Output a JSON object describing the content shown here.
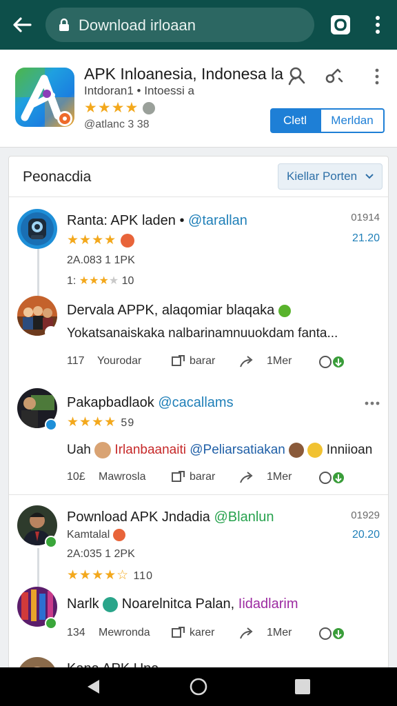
{
  "browser": {
    "url": "Download irloaan",
    "tab_count": "0"
  },
  "app": {
    "name": "APK Inloanesia, Indonesa la",
    "subtitle": "Intdoran1 • Intoessi a",
    "stars": "★★★★",
    "meta": "@atlanc 3 38",
    "primary_button": "Cletl",
    "secondary_button": "Merldan"
  },
  "feed": {
    "title": "Peonacdia",
    "sort_label": "Kiellar Porten",
    "items": [
      {
        "name": "Ranta: APK laden",
        "handle": "@tarallan",
        "time": "01914",
        "date": "21.20",
        "stars": "★★★★",
        "meta1": "2A.083 1  1PK",
        "meta2_pre": "1:",
        "meta2_stars": "★★★",
        "meta2_gray": "★",
        "meta2_post": "10"
      },
      {
        "name": "Dervala APPK, alaqomiar blaqaka",
        "body": "Yokatsanaiskaka nalbarinamnuuokdam fanta...",
        "count": "117",
        "a1": "Yourodar",
        "a2": "barar",
        "a3": "1Mer"
      },
      {
        "name": "Pakapbadlaok",
        "handle": "@cacallams",
        "stars": "★★★★",
        "rating": "59",
        "body_pre": "Uah",
        "body_red": "Irlanbaanaiti",
        "body_blue": "@Peliarsatiakan",
        "body_post": "Inniioan",
        "count": "10£",
        "a1": "Mawrosla",
        "a2": "barar",
        "a3": "1Mer"
      },
      {
        "name": "Pownload APK Jndadia",
        "handle": "@Blanlun",
        "time": "01929",
        "date": "20.20",
        "sub": "Kamtalal",
        "meta1": "2A:035 1  2PK",
        "stars": "★★★★",
        "half": "☆",
        "rating": "110"
      },
      {
        "name": "Narlk",
        "name_mid": "Noarelnitca Palan,",
        "handle": "Iidadlarim",
        "count": "134",
        "a1": "Mewronda",
        "a2": "karer",
        "a3": "1Mer"
      },
      {
        "name": "Kana APK Una..."
      }
    ]
  },
  "colors": {
    "topbar": "#0d4f4a",
    "accent_blue": "#1e7fd6",
    "star": "#f3a81c",
    "handle_blue": "#1f7fb8",
    "handle_green": "#27a24e"
  },
  "icons": [
    "back-arrow-icon",
    "lock-icon",
    "tab-switcher-icon",
    "overflow-menu-icon",
    "search-user-icon",
    "share-icon",
    "dropdown-chevron-icon",
    "comment-icon",
    "share-arrow-icon",
    "vote-icon",
    "nav-back-icon",
    "nav-home-icon",
    "nav-recents-icon"
  ]
}
